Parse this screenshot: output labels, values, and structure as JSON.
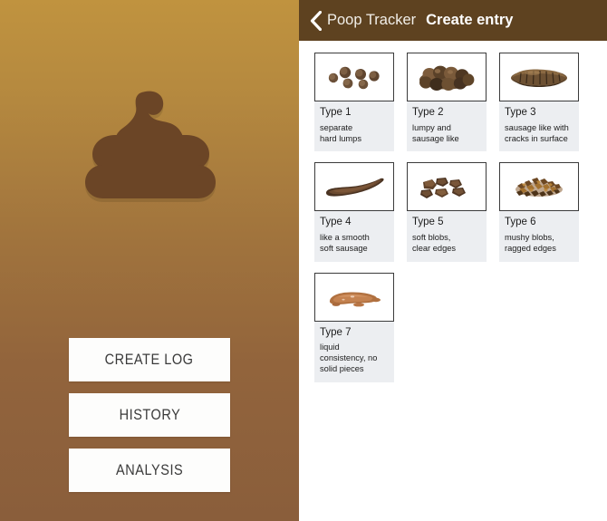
{
  "colors": {
    "gradient_top": "#c0933f",
    "gradient_bottom": "#8a5e3b",
    "titlebar": "#5e4220",
    "logo_fill": "#6b4526",
    "caption_bg": "#eceef1",
    "button_bg": "#fdfdfc",
    "button_text": "#3a3a3a"
  },
  "home": {
    "logo_name": "poop-logo",
    "buttons": [
      {
        "label": "CREATE LOG",
        "name": "create-log-button"
      },
      {
        "label": "HISTORY",
        "name": "history-button"
      },
      {
        "label": "ANALYSIS",
        "name": "analysis-button"
      }
    ]
  },
  "entry": {
    "back_icon": "chevron-left-icon",
    "app_name": "Poop Tracker",
    "screen_title": "Create entry",
    "types": [
      {
        "type": "Type 1",
        "description": "separate\nhard lumps",
        "art": "separate-hard-lumps-illustration"
      },
      {
        "type": "Type 2",
        "description": "lumpy and\nsausage like",
        "art": "lumpy-sausage-illustration"
      },
      {
        "type": "Type 3",
        "description": "sausage like with\ncracks in surface",
        "art": "cracked-sausage-illustration"
      },
      {
        "type": "Type 4",
        "description": "like a smooth\nsoft sausage",
        "art": "smooth-sausage-illustration"
      },
      {
        "type": "Type 5",
        "description": "soft blobs,\nclear edges",
        "art": "soft-blobs-illustration"
      },
      {
        "type": "Type 6",
        "description": "mushy blobs,\nragged edges",
        "art": "mushy-blobs-illustration"
      },
      {
        "type": "Type 7",
        "description": "liquid\nconsistency, no\nsolid pieces",
        "art": "liquid-illustration"
      }
    ]
  }
}
